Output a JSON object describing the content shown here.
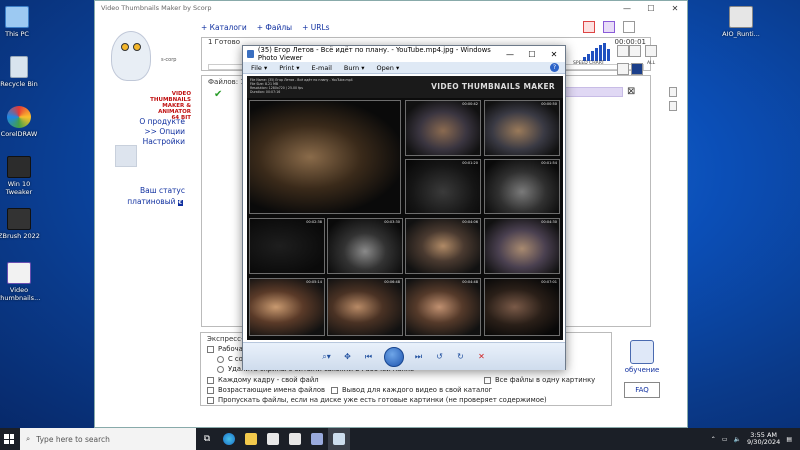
{
  "desktop": {
    "icons": [
      {
        "label": "This PC"
      },
      {
        "label": "Recycle Bin"
      },
      {
        "label": "CorelDRAW"
      },
      {
        "label": "Win 10 Tweaker"
      },
      {
        "label": "ZBrush 2022"
      },
      {
        "label": "Video thumbnails..."
      },
      {
        "label": "AIO_Runti..."
      }
    ]
  },
  "app": {
    "title": "Video Thumbnails Maker by Scorp",
    "brand": [
      "VIDEO",
      "THUMBNAILS",
      "MAKER & ANIMATOR",
      "64 BIT"
    ],
    "sorp": "s-corp",
    "menus": [
      "+ Каталоги",
      "+ Файлы",
      "+ URLs"
    ],
    "progress_label": "1 Готово",
    "time": "00:00:01",
    "files_label": "Файлов: 1",
    "links": [
      "О продукте",
      ">> Опции",
      "Настройки"
    ],
    "status_label": "Ваш статус",
    "status_value": "платиновый",
    "status_badge": "€",
    "speed_chart_label": "SPEED CHART",
    "all_label": "ALL",
    "express_label": "Экспресс-у",
    "options": {
      "rab": "Рабочая",
      "sozd": "С соз",
      "delete": "Удалить скрины с битыми связями в Рабочей папке",
      "own_file": "Каждому кадру - свой файл",
      "ascending": "Возрастающие имена файлов",
      "output": "Вывод для каждого видео в свой каталог",
      "all_one": "Все файлы в одну картинку",
      "skip": "Пропускать файлы, если на диске уже есть готовые картинки (не проверяет содержимое)"
    },
    "learn_label": "обучение",
    "faq_label": "FAQ"
  },
  "viewer": {
    "title": "(35) Егор Летов - Всё идёт по плану. - YouTube.mp4.jpg - Windows Photo Viewer",
    "menu": [
      "File",
      "Print",
      "E-mail",
      "Burn",
      "Open"
    ],
    "help": "?",
    "sheet_header": "VIDEO THUMBNAILS MAKER",
    "meta": [
      "File Name: (35) Егор Летов - Всё идёт по плану - YouTube.mp4",
      "File Size: 8.21 MB",
      "Resolution: 1280x720 / 25.00 fps",
      "Duration: 00:07:16"
    ],
    "timestamps": [
      "00:00:42",
      "00:00:50",
      "00:01:20",
      "00:01:54",
      "00:02:38",
      "00:03:30",
      "00:04:06",
      "00:04:30",
      "00:05:14",
      "00:06:48",
      "00:07:01",
      "00:04:48"
    ]
  },
  "taskbar": {
    "search_placeholder": "Type here to search",
    "time": "3:55 AM",
    "date": "9/30/2024"
  }
}
